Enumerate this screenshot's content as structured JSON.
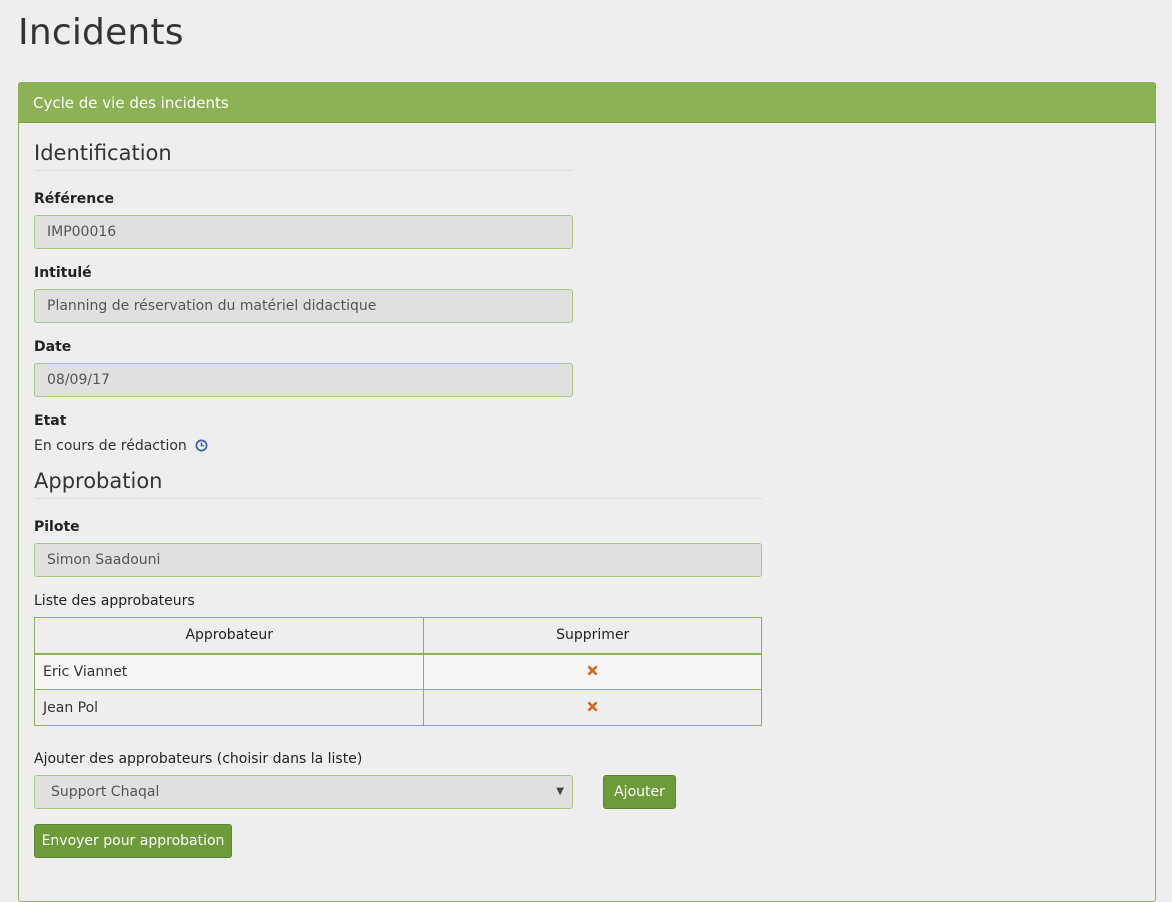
{
  "page_title": "Incidents",
  "panel": {
    "heading": "Cycle de vie des incidents"
  },
  "identification": {
    "title": "Identification",
    "reference": {
      "label": "Référence",
      "value": "IMP00016"
    },
    "intitule": {
      "label": "Intitulé",
      "value": "Planning de réservation du matériel didactique"
    },
    "date": {
      "label": "Date",
      "value": "08/09/17"
    },
    "etat": {
      "label": "Etat",
      "value": "En cours de rédaction",
      "icon": "clock-icon",
      "icon_color": "#3b5bb8"
    }
  },
  "approbation": {
    "title": "Approbation",
    "pilote": {
      "label": "Pilote",
      "value": "Simon Saadouni"
    },
    "list_label": "Liste des approbateurs",
    "table": {
      "headers": [
        "Approbateur",
        "Supprimer"
      ],
      "rows": [
        {
          "name": "Eric Viannet",
          "delete_icon": "delete-x-icon"
        },
        {
          "name": "Jean Pol",
          "delete_icon": "delete-x-icon"
        }
      ]
    },
    "add_label": "Ajouter des approbateurs (choisir dans la liste)",
    "select_value": "Support Chaqal",
    "add_button": "Ajouter",
    "send_button": "Envoyer pour approbation"
  },
  "colors": {
    "accent": "#8db255",
    "button": "#6e9b3a",
    "delete_icon": "#d9661f"
  }
}
